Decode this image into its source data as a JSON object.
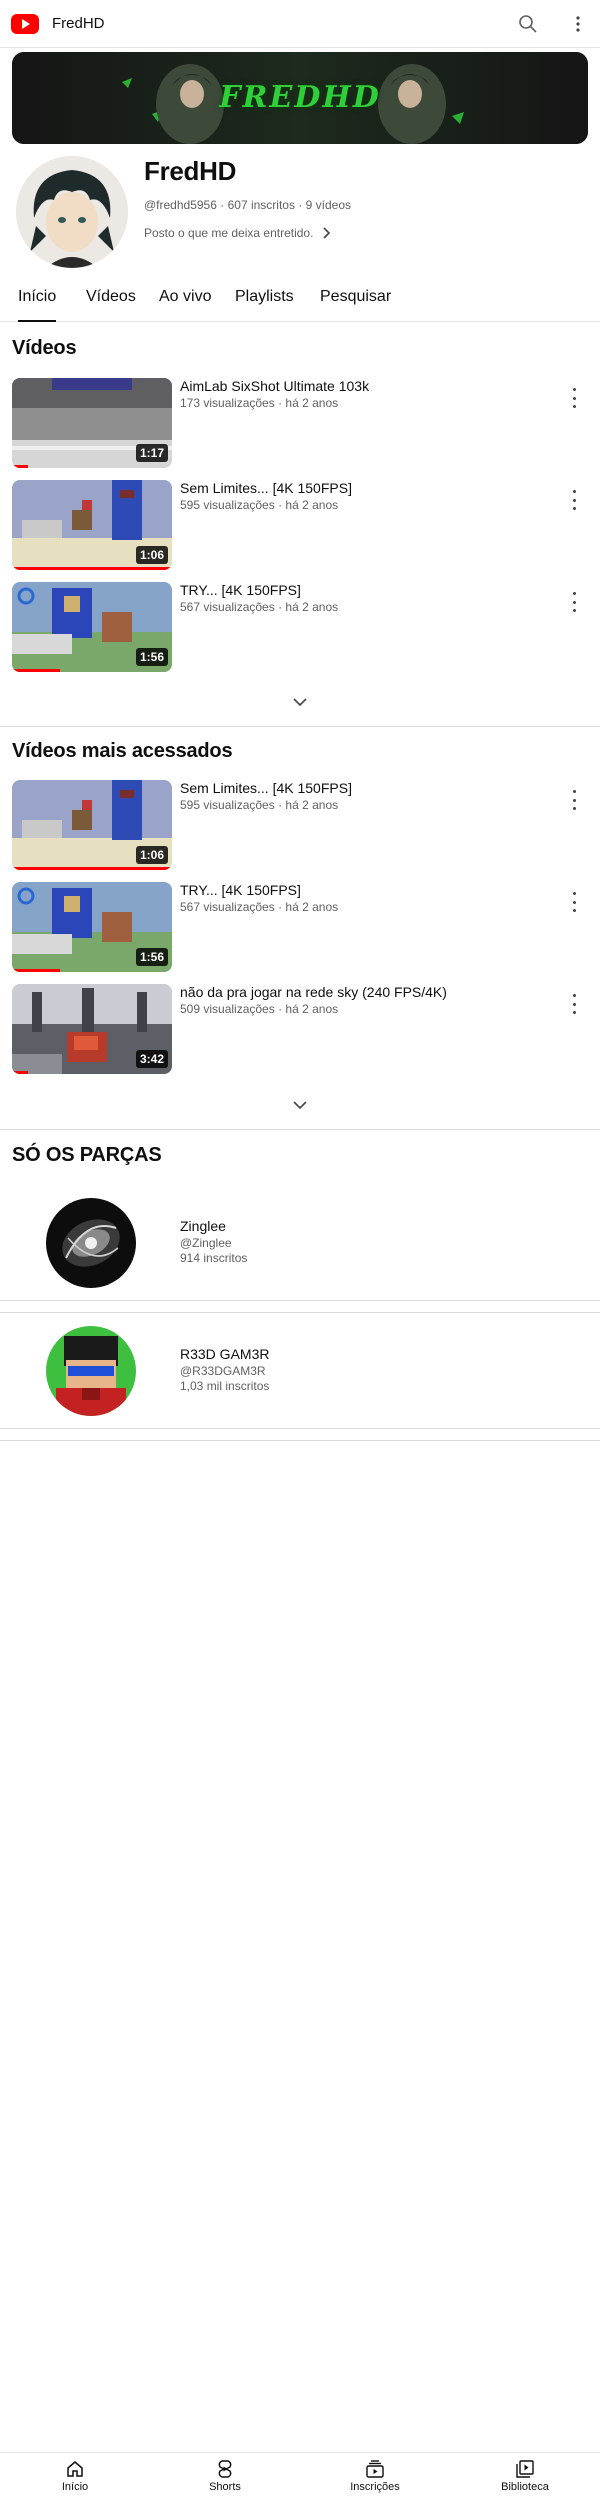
{
  "header": {
    "channel_title": "FredHD",
    "logo_icon": "youtube-logo-icon",
    "search_icon": "search-icon",
    "more_icon": "more-vert-icon"
  },
  "banner": {
    "text": "FREDHD"
  },
  "channel": {
    "name": "FredHD",
    "handle": "@fredhd5956",
    "sep": "·",
    "subscribers": "607 inscritos",
    "video_count": "9 vídeos",
    "description": "Posto o que me deixa entretido."
  },
  "tabs": [
    {
      "label": "Início",
      "active": true
    },
    {
      "label": "Vídeos"
    },
    {
      "label": "Ao vivo"
    },
    {
      "label": "Playlists"
    },
    {
      "label": "Pesquisar"
    }
  ],
  "videos_section": {
    "title": "Vídeos",
    "items": [
      {
        "title": "AimLab SixShot Ultimate 103k",
        "views": "173 visualizações",
        "age": "há 2 anos",
        "duration": "1:17",
        "watched": 0.1
      },
      {
        "title": "Sem Limites... [4K 150FPS]",
        "views": "595 visualizações",
        "age": "há 2 anos",
        "duration": "1:06",
        "watched": 1.0
      },
      {
        "title": "TRY... [4K 150FPS]",
        "views": "567 visualizações",
        "age": "há 2 anos",
        "duration": "1:56",
        "watched": 0.3
      }
    ]
  },
  "popular_section": {
    "title": "Vídeos mais acessados",
    "items": [
      {
        "title": "Sem Limites... [4K 150FPS]",
        "views": "595 visualizações",
        "age": "há 2 anos",
        "duration": "1:06",
        "watched": 1.0
      },
      {
        "title": "TRY... [4K 150FPS]",
        "views": "567 visualizações",
        "age": "há 2 anos",
        "duration": "1:56",
        "watched": 0.3
      },
      {
        "title": "não da pra jogar na rede sky (240 FPS/4K)",
        "views": "509 visualizações",
        "age": "há 2 anos",
        "duration": "3:42",
        "watched": 0.1
      }
    ]
  },
  "featured_section": {
    "title": "SÓ OS PARÇAS",
    "channels": [
      {
        "name": "Zinglee",
        "handle": "@Zinglee",
        "subscribers": "914 inscritos"
      },
      {
        "name": "R33D GAM3R",
        "handle": "@R33DGAM3R",
        "subscribers": "1,03 mil inscritos"
      }
    ]
  },
  "bottom_nav": [
    {
      "label": "Início",
      "icon": "home-icon"
    },
    {
      "label": "Shorts",
      "icon": "shorts-icon"
    },
    {
      "label": "Inscrições",
      "icon": "subscriptions-icon"
    },
    {
      "label": "Biblioteca",
      "icon": "library-icon"
    }
  ],
  "colors": {
    "brand": "#ff0000",
    "text": "#0f0f0f",
    "secondary_text": "#606060"
  }
}
